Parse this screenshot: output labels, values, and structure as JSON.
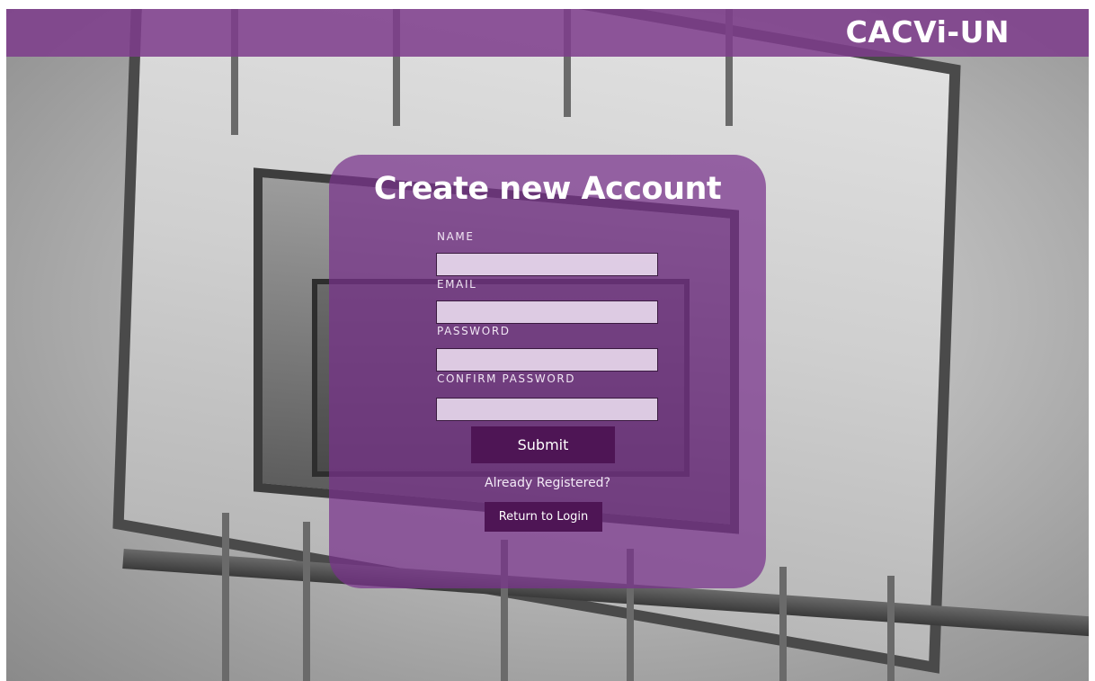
{
  "header": {
    "brand": "CACVi-UN"
  },
  "form": {
    "title": "Create new Account",
    "fields": [
      {
        "label": "NAME",
        "value": ""
      },
      {
        "label": "EMAIL",
        "value": ""
      },
      {
        "label": "PASSWORD",
        "value": ""
      },
      {
        "label": "CONFIRM PASSWORD",
        "value": ""
      }
    ],
    "submit_label": "Submit",
    "already_registered_text": "Already Registered?",
    "return_label": "Return to Login"
  },
  "colors": {
    "header_overlay": "#7e3c8c",
    "card_overlay": "#78328c",
    "button": "#4e1555",
    "input_bg": "#ecdef0"
  }
}
